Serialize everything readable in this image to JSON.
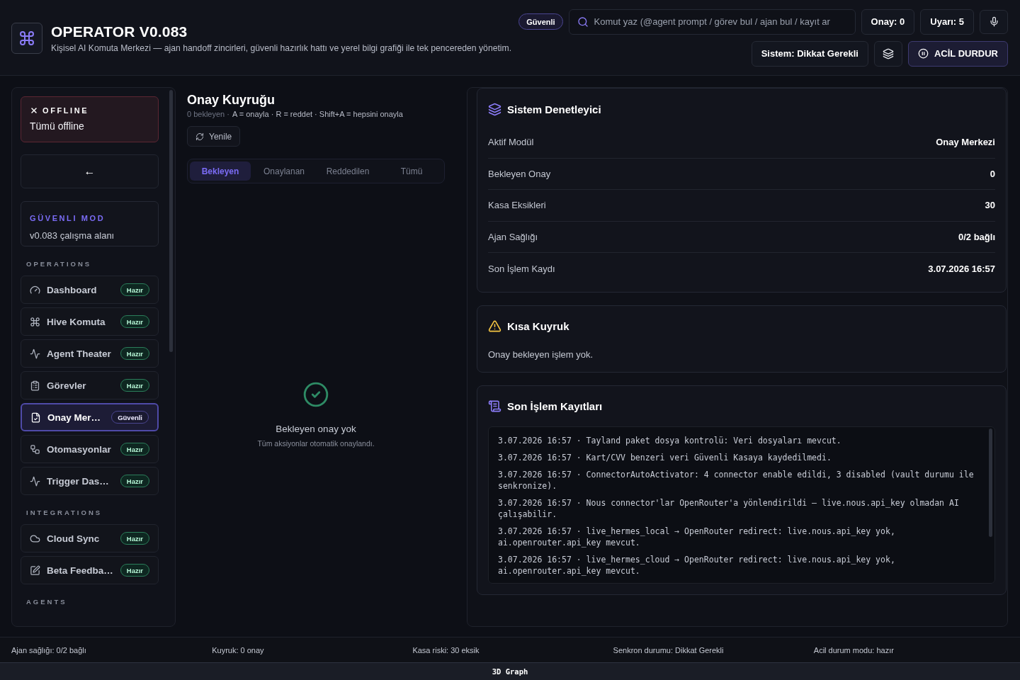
{
  "header": {
    "title": "OPERATOR V0.083",
    "subtitle": "Kişisel AI Komuta Merkezi — ajan handoff zincirleri, güvenli hazırlık hattı ve yerel bilgi grafiği ile tek pencereden yönetim.",
    "mode_badge": "Güvenli",
    "search": {
      "placeholder": "Komut yaz (@agent prompt / görev bul / ajan bul / kayıt ar"
    },
    "counters": [
      "Onay: 0",
      "Uyarı: 5"
    ],
    "status_button": "Sistem: Dikkat Gerekli",
    "stop_button": "ACİL DURDUR"
  },
  "sidebar": {
    "offline_card": {
      "title": "OFFLINE",
      "text": "Tümü offline"
    },
    "back_button": "←",
    "mode_card": {
      "title": "GÜVENLI MOD",
      "text": "v0.083 çalışma alanı"
    },
    "sections": [
      {
        "title": "OPERATIONS",
        "items": [
          {
            "label": "Dashboard",
            "badge": {
              "text": "Hazır",
              "kind": "ready"
            },
            "selected": false
          },
          {
            "label": "Hive Komuta",
            "badge": {
              "text": "Hazır",
              "kind": "ready"
            },
            "selected": false
          },
          {
            "label": "Agent Theater",
            "badge": {
              "text": "Hazır",
              "kind": "ready"
            },
            "selected": false
          },
          {
            "label": "Görevler",
            "badge": {
              "text": "Hazır",
              "kind": "ready"
            },
            "selected": false
          },
          {
            "label": "Onay Mer…",
            "badge": {
              "text": "Güvenli",
              "kind": "safe"
            },
            "selected": true
          },
          {
            "label": "Otomasyonlar",
            "badge": {
              "text": "Hazır",
              "kind": "ready"
            },
            "selected": false
          },
          {
            "label": "Trigger Das…",
            "badge": {
              "text": "Hazır",
              "kind": "ready"
            },
            "selected": false
          }
        ]
      },
      {
        "title": "INTEGRATIONS",
        "items": [
          {
            "label": "Cloud Sync",
            "badge": {
              "text": "Hazır",
              "kind": "ready"
            },
            "selected": false
          },
          {
            "label": "Beta Feedba…",
            "badge": {
              "text": "Hazır",
              "kind": "ready"
            },
            "selected": false
          }
        ]
      },
      {
        "title": "AGENTS"
      }
    ]
  },
  "queue": {
    "title": "Onay Kuyruğu",
    "count": "0 bekleyen ·",
    "shortcuts": "A = onayla · R = reddet · Shift+A = hepsini onayla",
    "refresh_button": "Yenile",
    "tabs": [
      {
        "label": "Bekleyen",
        "selected": true
      },
      {
        "label": "Onaylanan",
        "selected": false
      },
      {
        "label": "Reddedilen",
        "selected": false
      },
      {
        "label": "Tümü",
        "selected": false
      }
    ],
    "empty_state": {
      "title": "Bekleyen onay yok",
      "text": "Tüm aksiyonlar otomatik onaylandı."
    }
  },
  "inspector": {
    "title": "Sistem Denetleyici",
    "rows": [
      {
        "label": "Aktif Modül",
        "value": "Onay Merkezi"
      },
      {
        "label": "Bekleyen Onay",
        "value": "0"
      },
      {
        "label": "Kasa Eksikleri",
        "value": "30"
      },
      {
        "label": "Ajan Sağlığı",
        "value": "0/2 bağlı"
      },
      {
        "label": "Son İşlem Kaydı",
        "value": "3.07.2026 16:57"
      }
    ]
  },
  "short_queue": {
    "title": "Kısa Kuyruk",
    "text": "Onay bekleyen işlem yok."
  },
  "activity_log": {
    "title": "Son İşlem Kayıtları",
    "entries": [
      "3.07.2026 16:57 · Tayland paket dosya kontrolü: Veri dosyaları mevcut.",
      "3.07.2026 16:57 · Kart/CVV benzeri veri Güvenli Kasaya kaydedilmedi.",
      "3.07.2026 16:57 · ConnectorAutoActivator: 4 connector enable edildi, 3 disabled (vault durumu ile senkronize).",
      "3.07.2026 16:57 · Nous connector'lar OpenRouter'a yönlendirildi — live.nous.api_key olmadan AI çalışabilir.",
      "3.07.2026 16:57 · live_hermes_local → OpenRouter redirect: live.nous.api_key yok, ai.openrouter.api_key mevcut.",
      "3.07.2026 16:57 · live_hermes_cloud → OpenRouter redirect: live.nous.api_key yok, ai.openrouter.api_key mevcut."
    ]
  },
  "status_bar": {
    "items": [
      "Ajan sağlığı: 0/2 bağlı",
      "Kuyruk: 0 onay",
      "Kasa riski: 30 eksik",
      "Senkron durumu: Dikkat Gerekli",
      "Acil durum modu: hazır"
    ]
  },
  "graph_button": "3D Graph"
}
